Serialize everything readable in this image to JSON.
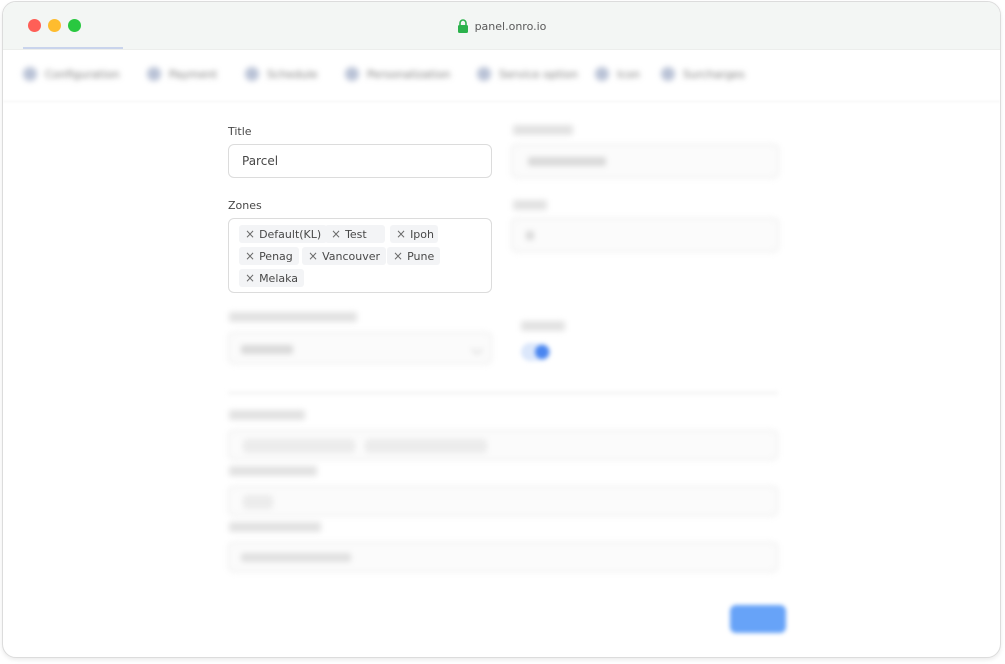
{
  "browser": {
    "url": "panel.onro.io"
  },
  "tabs": [
    {
      "label": "Configuration"
    },
    {
      "label": "Payment"
    },
    {
      "label": "Schedule"
    },
    {
      "label": "Personalization"
    },
    {
      "label": "Service option"
    },
    {
      "label": "Icon"
    },
    {
      "label": "Surcharges"
    }
  ],
  "form": {
    "title_label": "Title",
    "title_value": "Parcel",
    "zones_label": "Zones",
    "zones": [
      "Default(KL)",
      "Test",
      "Ipoh",
      "Penag",
      "Vancouver",
      "Pune",
      "Melaka"
    ],
    "chip_remove_glyph": "×"
  },
  "colors": {
    "close_dot": "#fe5f57",
    "minimize_dot": "#febc2e",
    "maximize_dot": "#29c840",
    "lock_icon": "#2bb24c",
    "accent": "#4a86f0"
  }
}
